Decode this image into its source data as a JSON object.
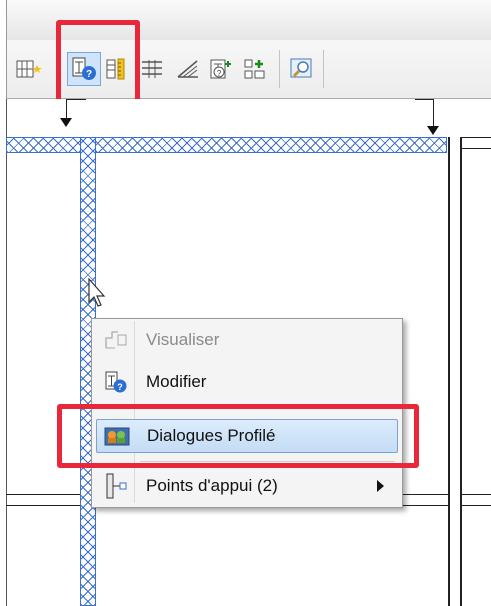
{
  "toolbar": {
    "icons": [
      "grid-star-icon",
      "section-edit-icon",
      "ruler-icon",
      "align-icon",
      "slope-icon",
      "query-icon",
      "add-section-icon",
      "zoom-window-icon"
    ]
  },
  "context_menu": {
    "items": [
      {
        "label": "Visualiser",
        "icon": "view-profile-icon",
        "state": "disabled"
      },
      {
        "label": "Modifier",
        "icon": "section-edit-icon",
        "state": "normal"
      },
      {
        "label": "Dialogues Profilé",
        "icon": "profile-dialog-icon",
        "state": "selected"
      },
      {
        "label": "Points d'appui (2)",
        "icon": "support-points-icon",
        "state": "submenu"
      }
    ]
  },
  "colors": {
    "highlight_red": "#e8283a",
    "hatch_blue": "#3a6fd0",
    "selection_blue": "#c4dcf5"
  }
}
